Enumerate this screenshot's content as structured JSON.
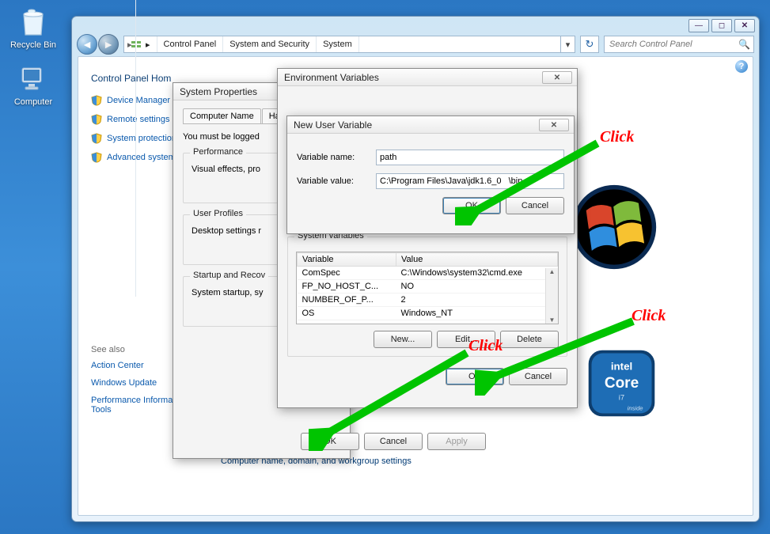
{
  "desktop": {
    "recycle_bin": "Recycle Bin",
    "computer": "Computer"
  },
  "explorer": {
    "breadcrumbs": [
      "Control Panel",
      "System and Security",
      "System"
    ],
    "search_placeholder": "Search Control Panel",
    "cphome": "Control Panel Hom",
    "sidelinks": [
      "Device Manager",
      "Remote settings",
      "System protection",
      "Advanced system s"
    ],
    "seealso_label": "See also",
    "seealso_links": [
      "Action Center",
      "Windows Update",
      "Performance Information and Tools"
    ],
    "footer": "Computer name, domain, and workgroup settings"
  },
  "sysprops": {
    "title": "System Properties",
    "tabs": [
      "Computer Name",
      "Ha"
    ],
    "logged_msg": "You must be logged",
    "group_perf": "Performance",
    "perf_text": "Visual effects, pro",
    "group_user": "User Profiles",
    "user_text": "Desktop settings r",
    "group_start": "Startup and Recov",
    "start_text": "System startup, sy",
    "ok": "OK",
    "cancel": "Cancel",
    "apply": "Apply"
  },
  "env": {
    "title": "Environment Variables",
    "sysvars_label": "System variables",
    "col_var": "Variable",
    "col_val": "Value",
    "rows": [
      {
        "v": "ComSpec",
        "val": "C:\\Windows\\system32\\cmd.exe"
      },
      {
        "v": "FP_NO_HOST_C...",
        "val": "NO"
      },
      {
        "v": "NUMBER_OF_P...",
        "val": "2"
      },
      {
        "v": "OS",
        "val": "Windows_NT"
      }
    ],
    "new": "New...",
    "edit": "Edit...",
    "delete": "Delete",
    "ok": "OK",
    "cancel": "Cancel"
  },
  "nuv": {
    "title": "New User Variable",
    "name_label": "Variable name:",
    "value_label": "Variable value:",
    "name_value": "path",
    "value_value": "C:\\Program Files\\Java\\jdk1.6_0   \\bin",
    "ok": "OK",
    "cancel": "Cancel"
  },
  "annotations": {
    "click": "Click"
  }
}
